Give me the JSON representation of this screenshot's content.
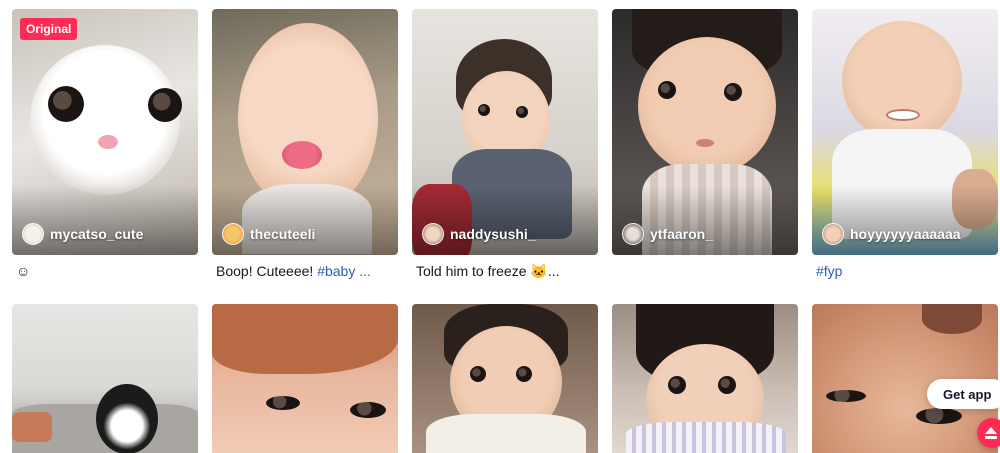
{
  "badges": {
    "original": "Original"
  },
  "videos_row1": [
    {
      "author": "mycatso_cute",
      "caption_text": "☺",
      "caption_tag": ""
    },
    {
      "author": "thecuteeli",
      "caption_text": "Boop! Cuteeee! ",
      "caption_tag": "#baby ..."
    },
    {
      "author": "naddysushi_",
      "caption_text": "Told him to freeze 🐱...",
      "caption_tag": ""
    },
    {
      "author": "ytfaaron_",
      "caption_text": "",
      "caption_tag": ""
    },
    {
      "author": "hoyyyyyyaaaaaa",
      "caption_text": "",
      "caption_tag": "#fyp"
    }
  ],
  "floating": {
    "get_app": "Get app"
  },
  "colors": {
    "accent": "#fe2c55",
    "hashtag": "#2b5db9"
  },
  "icons": {
    "scroll_top": "arrow-up-icon"
  }
}
